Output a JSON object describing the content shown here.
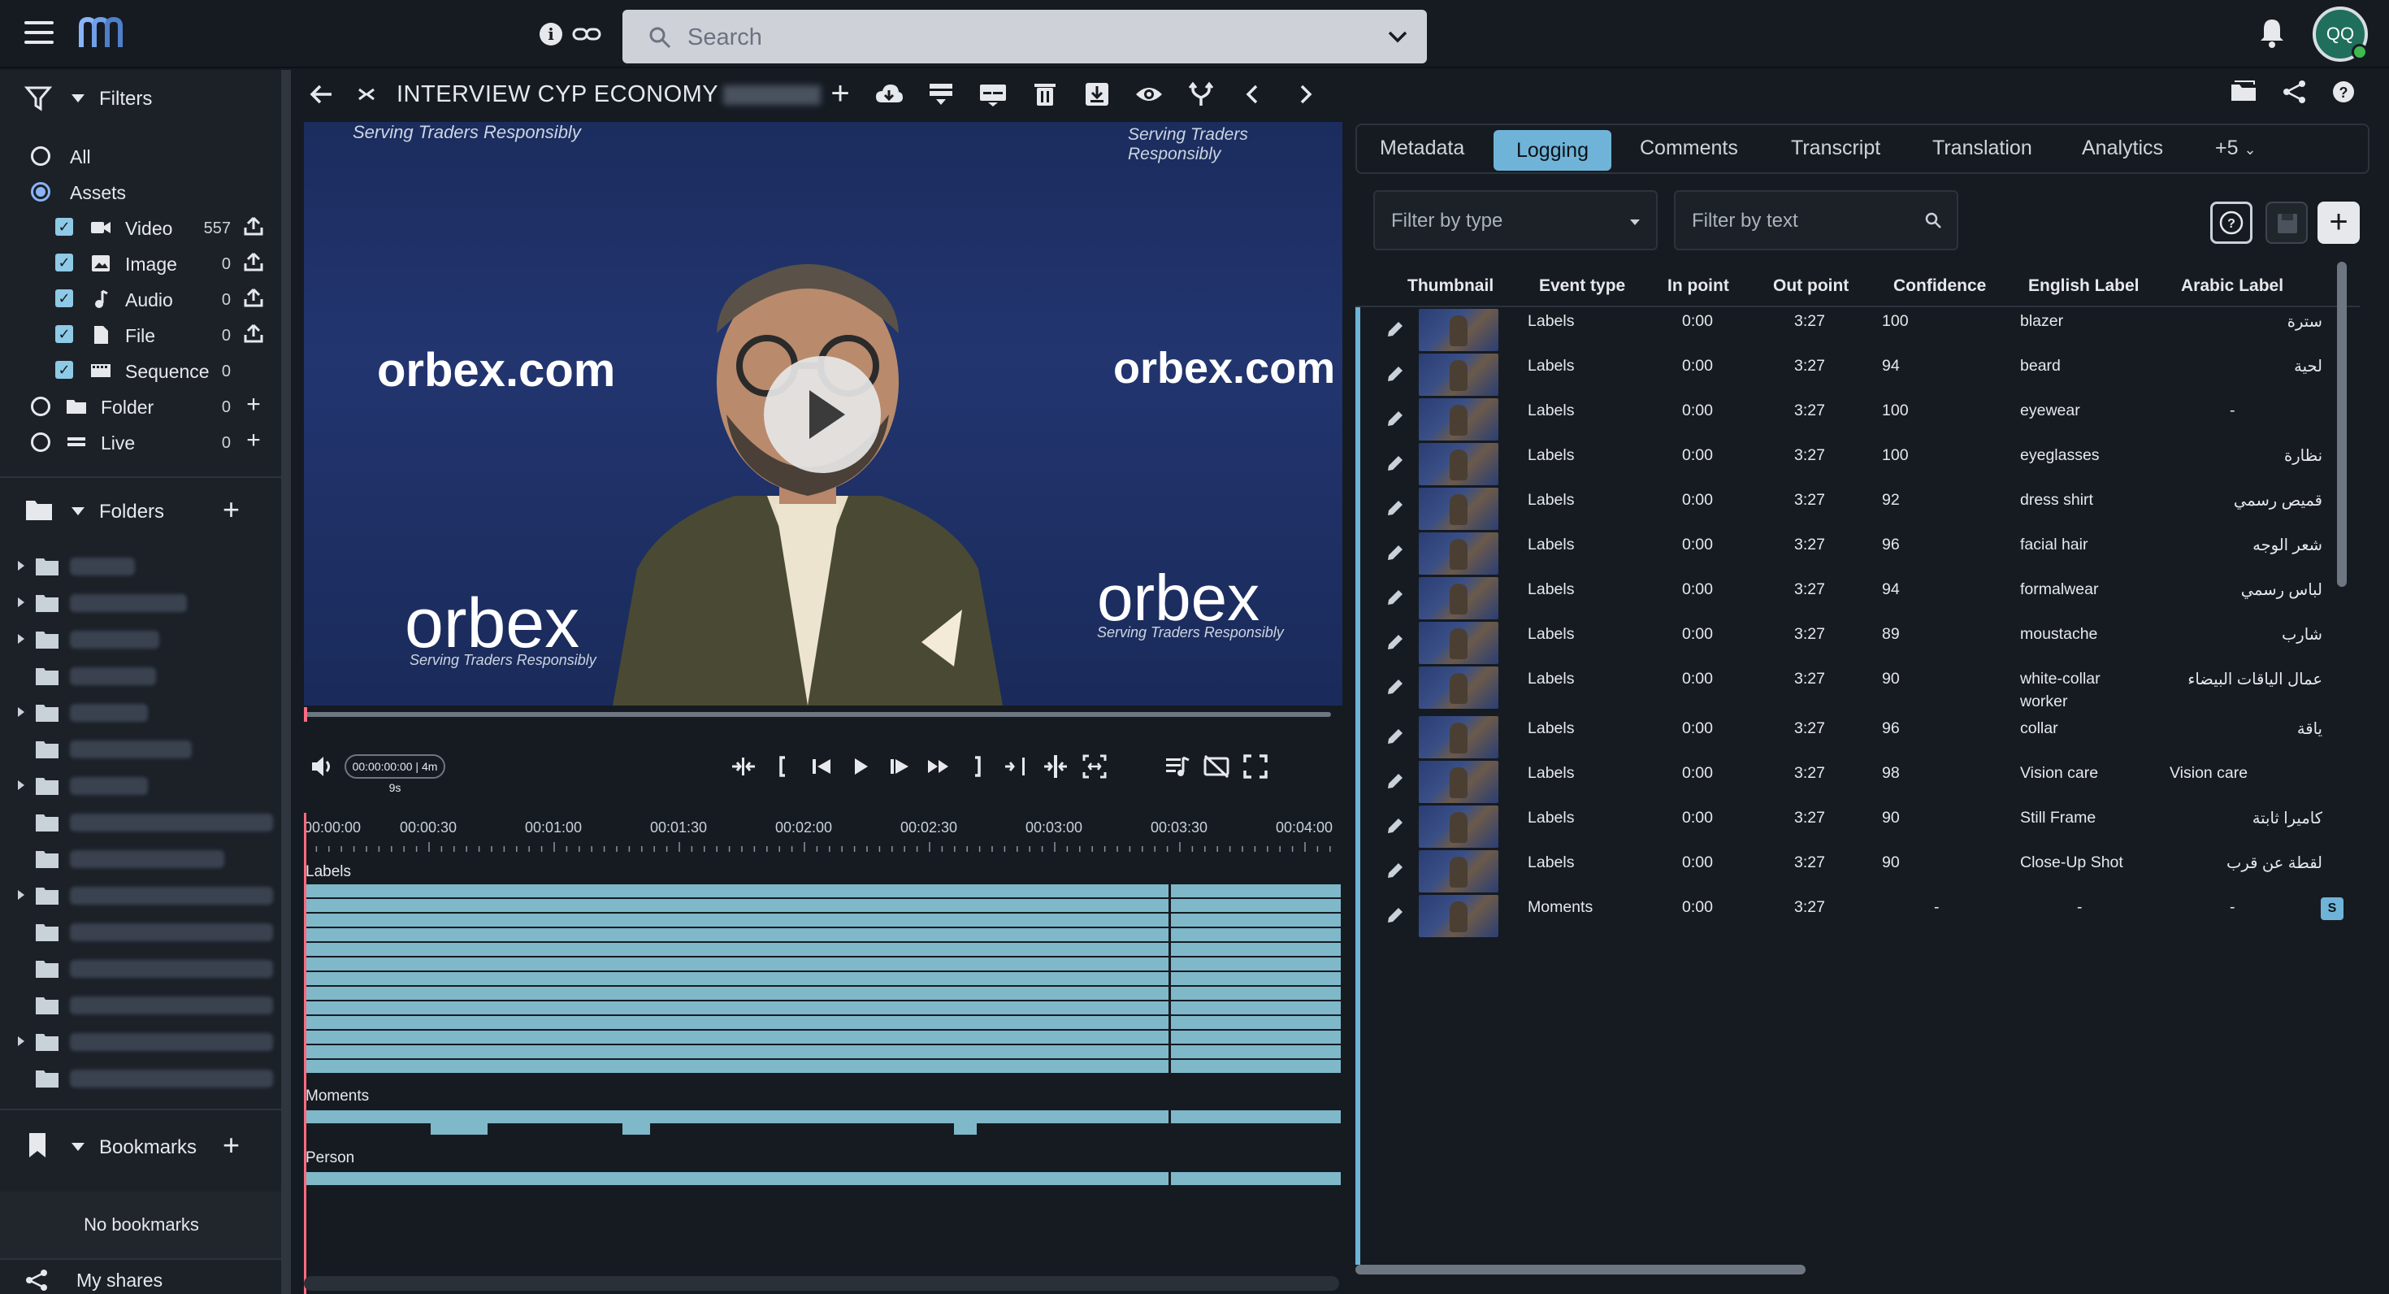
{
  "search": {
    "placeholder": "Search"
  },
  "user": {
    "initials": "QQ"
  },
  "sidebar": {
    "filters_title": "Filters",
    "filters": [
      {
        "label": "All",
        "type": "radio",
        "checked": false,
        "count": "",
        "action": ""
      },
      {
        "label": "Assets",
        "type": "radio",
        "checked": true,
        "count": "",
        "action": ""
      },
      {
        "label": "Video",
        "type": "check",
        "checked": true,
        "count": "557",
        "action": "upload",
        "icon": "video-icon"
      },
      {
        "label": "Image",
        "type": "check",
        "checked": true,
        "count": "0",
        "action": "upload",
        "icon": "image-icon"
      },
      {
        "label": "Audio",
        "type": "check",
        "checked": true,
        "count": "0",
        "action": "upload",
        "icon": "audio-icon"
      },
      {
        "label": "File",
        "type": "check",
        "checked": true,
        "count": "0",
        "action": "upload",
        "icon": "file-icon"
      },
      {
        "label": "Sequence",
        "type": "check",
        "checked": true,
        "count": "0",
        "action": "",
        "icon": "sequence-icon"
      },
      {
        "label": "Folder",
        "type": "radio",
        "checked": false,
        "count": "0",
        "action": "add",
        "icon": "folder-icon"
      },
      {
        "label": "Live",
        "type": "radio",
        "checked": false,
        "count": "0",
        "action": "add",
        "icon": "live-icon"
      }
    ],
    "folders_title": "Folders",
    "bookmarks_title": "Bookmarks",
    "no_bookmarks": "No bookmarks",
    "my_shares": "My shares"
  },
  "player": {
    "title": "INTERVIEW CYP ECONOMY",
    "timecode": "00:00:00:00 | 4m 9s",
    "brand_text": "orbex.com",
    "brand_short": "orbex",
    "tagline": "Serving Traders Responsibly",
    "ruler": [
      "00:00:00",
      "00:00:30",
      "00:01:00",
      "00:01:30",
      "00:02:00",
      "00:02:30",
      "00:03:00",
      "00:03:30",
      "00:04:00"
    ],
    "tracks": [
      "Labels",
      "Moments",
      "Person"
    ]
  },
  "tabs": [
    "Metadata",
    "Logging",
    "Comments",
    "Transcript",
    "Translation",
    "Analytics"
  ],
  "tabs_active": "Logging",
  "tabs_more": "+5",
  "logging": {
    "filter_type_placeholder": "Filter by type",
    "filter_text_placeholder": "Filter by text",
    "columns": [
      "Thumbnail",
      "Event type",
      "In point",
      "Out point",
      "Confidence",
      "English Label",
      "Arabic Label"
    ],
    "rows": [
      {
        "type": "Labels",
        "in": "0:00",
        "out": "3:27",
        "conf": "100",
        "en": "blazer",
        "ar": "سترة"
      },
      {
        "type": "Labels",
        "in": "0:00",
        "out": "3:27",
        "conf": "94",
        "en": "beard",
        "ar": "لحية"
      },
      {
        "type": "Labels",
        "in": "0:00",
        "out": "3:27",
        "conf": "100",
        "en": "eyewear",
        "ar": "-"
      },
      {
        "type": "Labels",
        "in": "0:00",
        "out": "3:27",
        "conf": "100",
        "en": "eyeglasses",
        "ar": "نظارة"
      },
      {
        "type": "Labels",
        "in": "0:00",
        "out": "3:27",
        "conf": "92",
        "en": "dress shirt",
        "ar": "قميص رسمي"
      },
      {
        "type": "Labels",
        "in": "0:00",
        "out": "3:27",
        "conf": "96",
        "en": "facial hair",
        "ar": "شعر الوجه"
      },
      {
        "type": "Labels",
        "in": "0:00",
        "out": "3:27",
        "conf": "94",
        "en": "formalwear",
        "ar": "لباس رسمي"
      },
      {
        "type": "Labels",
        "in": "0:00",
        "out": "3:27",
        "conf": "89",
        "en": "moustache",
        "ar": "شارب"
      },
      {
        "type": "Labels",
        "in": "0:00",
        "out": "3:27",
        "conf": "90",
        "en": "white-collar",
        "en2": "worker",
        "ar": "عمال الياقات البيضاء"
      },
      {
        "type": "Labels",
        "in": "0:00",
        "out": "3:27",
        "conf": "96",
        "en": "collar",
        "ar": "ياقة"
      },
      {
        "type": "Labels",
        "in": "0:00",
        "out": "3:27",
        "conf": "98",
        "en": "Vision care",
        "ar": "Vision care"
      },
      {
        "type": "Labels",
        "in": "0:00",
        "out": "3:27",
        "conf": "90",
        "en": "Still Frame",
        "ar": "كاميرا ثابتة"
      },
      {
        "type": "Labels",
        "in": "0:00",
        "out": "3:27",
        "conf": "90",
        "en": "Close-Up Shot",
        "ar": "لقطة عن قرب"
      },
      {
        "type": "Moments",
        "in": "0:00",
        "out": "3:27",
        "conf": "-",
        "en": "-",
        "ar": "-"
      }
    ],
    "chip": "S"
  },
  "colors": {
    "accent": "#6fb4d8",
    "track": "#7fb8c9",
    "playhead": "#ff6b81"
  }
}
